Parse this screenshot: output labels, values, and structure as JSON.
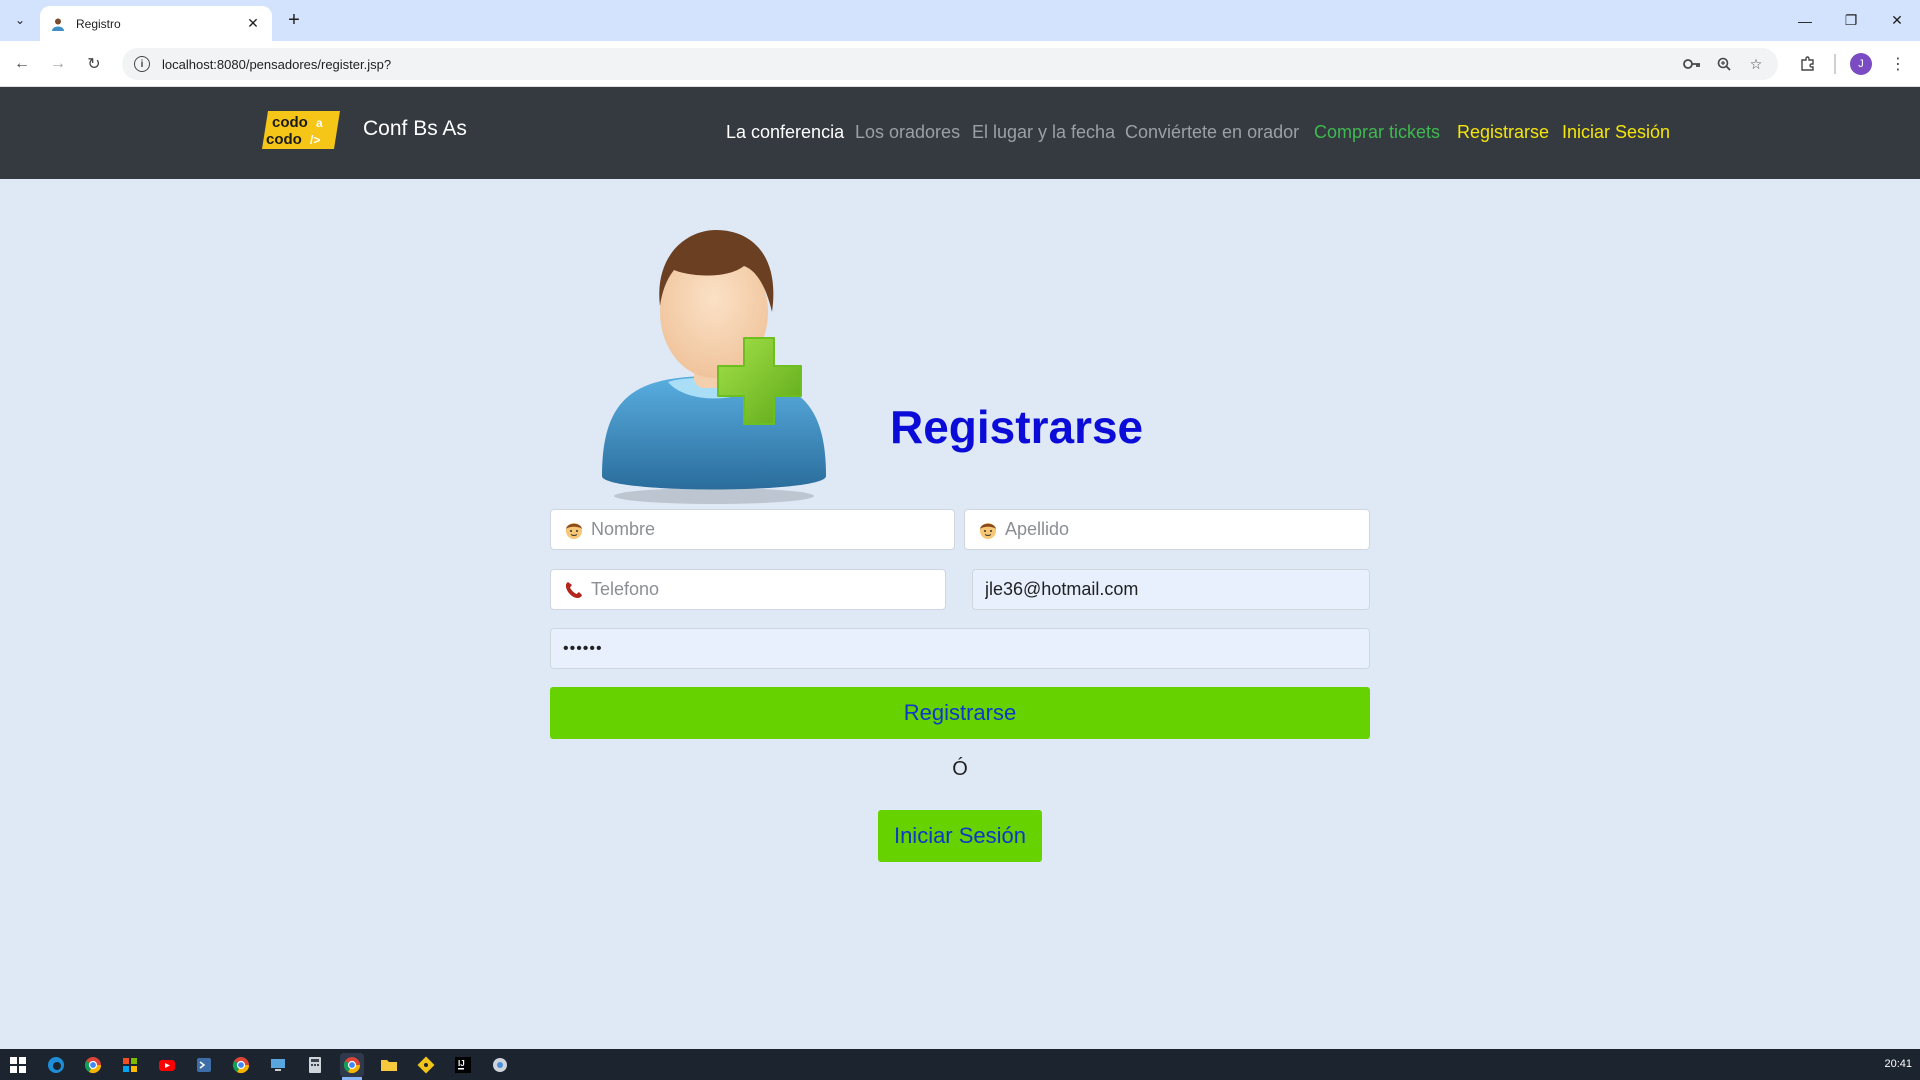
{
  "browser": {
    "tab_title": "Registro",
    "url": "localhost:8080/pensadores/register.jsp?",
    "profile_initial": "J"
  },
  "navbar": {
    "logo_line1": "codo",
    "logo_line2": "codo",
    "brand": "Conf Bs As",
    "items": [
      {
        "label": "La conferencia",
        "color": "#ffffff"
      },
      {
        "label": "Los oradores",
        "color": "#9aa0a6"
      },
      {
        "label": "El lugar y la fecha",
        "color": "#9aa0a6"
      },
      {
        "label": "Conviértete en orador",
        "color": "#9aa0a6"
      },
      {
        "label": "Comprar tickets",
        "color": "#3fb950"
      },
      {
        "label": "Registrarse",
        "color": "#f5e50b"
      },
      {
        "label": "Iniciar Sesión",
        "color": "#f5e50b"
      }
    ]
  },
  "form": {
    "title": "Registrarse",
    "nombre": {
      "placeholder": "Nombre",
      "value": ""
    },
    "apellido": {
      "placeholder": "Apellido",
      "value": ""
    },
    "telefono": {
      "placeholder": "Telefono",
      "value": ""
    },
    "email": {
      "placeholder": "",
      "value": "jle36@hotmail.com"
    },
    "password": {
      "placeholder": "",
      "value": "••••••"
    },
    "submit_label": "Registrarse",
    "or_text": "Ó",
    "login_label": "Iniciar Sesión"
  },
  "taskbar": {
    "clock": "20:41"
  },
  "colors": {
    "page_bg": "#dfe9f5",
    "navbar_bg": "#343a40",
    "button_green": "#66d200",
    "title_blue": "#0c0cd8"
  }
}
